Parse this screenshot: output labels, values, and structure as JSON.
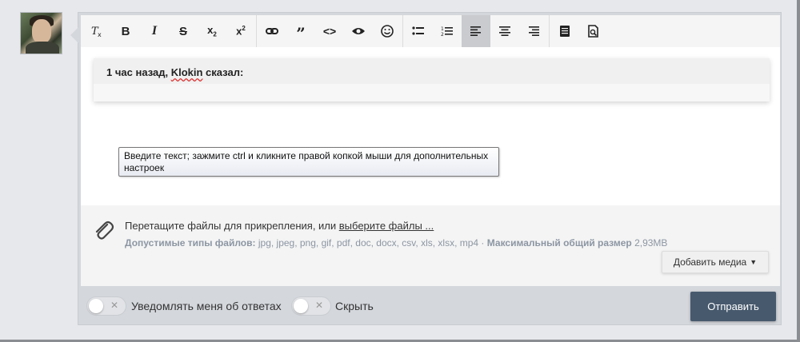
{
  "toolbar": {
    "buttons": [
      {
        "name": "clear-format-icon"
      },
      {
        "name": "bold-icon"
      },
      {
        "name": "italic-icon"
      },
      {
        "name": "strikethrough-icon"
      },
      {
        "name": "subscript-icon"
      },
      {
        "name": "superscript-icon"
      },
      {
        "name": "link-icon"
      },
      {
        "name": "quote-icon"
      },
      {
        "name": "code-icon"
      },
      {
        "name": "spoiler-eye-icon"
      },
      {
        "name": "smiley-icon"
      },
      {
        "name": "bulleted-list-icon"
      },
      {
        "name": "numbered-list-icon"
      },
      {
        "name": "align-left-icon",
        "active": true
      },
      {
        "name": "align-center-icon"
      },
      {
        "name": "align-right-icon"
      },
      {
        "name": "toggle-bbcode-icon"
      },
      {
        "name": "preview-icon"
      }
    ]
  },
  "quote": {
    "prefix": "1 час назад, ",
    "user": "Klokin",
    "suffix": " сказал:"
  },
  "tooltip": {
    "text": "Введите текст; зажмите ctrl и кликните правой копкой мыши для дополнительных настроек"
  },
  "attach": {
    "drop_text": "Перетащите файлы для прикрепления, или ",
    "choose_link": "выберите файлы ...",
    "types_label": "Допустимые типы файлов:",
    "types_value": " jpg, jpeg, png, gif, pdf, doc, docx, csv, xls, xlsx, mp4 · ",
    "max_label": "Максимальный общий размер",
    "max_value": " 2,93MB",
    "media_button": "Добавить медиа"
  },
  "footer": {
    "notify_label": "Уведомлять меня об ответах",
    "hide_label": "Скрыть",
    "submit_label": "Отправить"
  },
  "colors": {
    "submit_bg": "#47596d",
    "active_tool": "#c9cbce"
  }
}
